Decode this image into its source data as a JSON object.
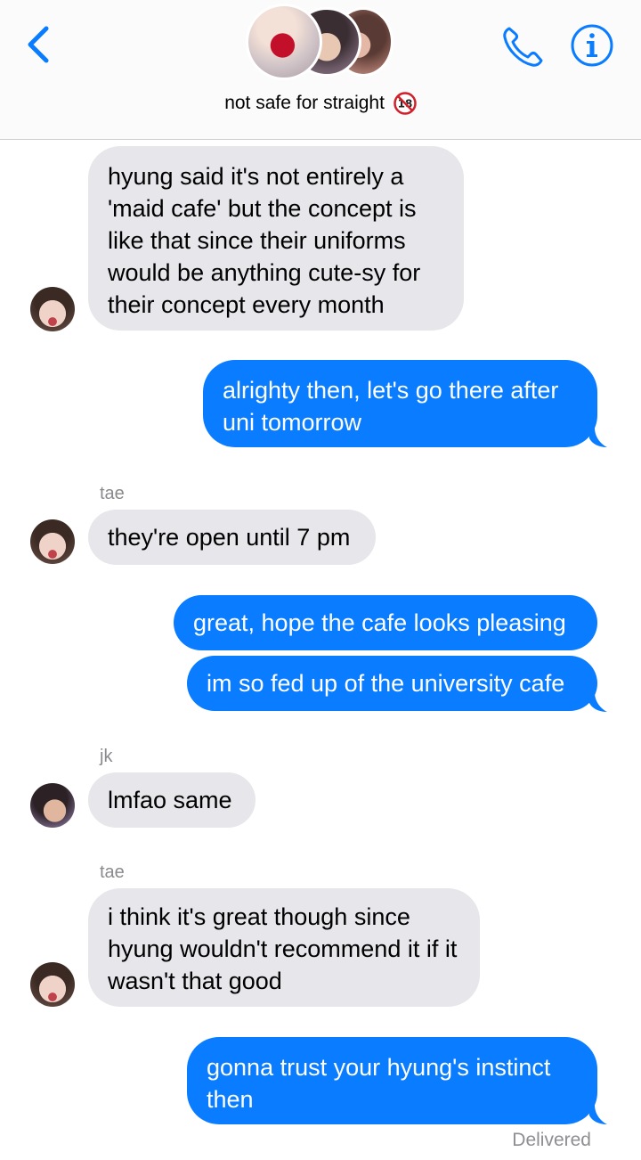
{
  "header": {
    "group_name": "not safe for straight",
    "emoji_badge": "🔞",
    "back_icon": "chevron-left-icon",
    "call_icon": "phone-icon",
    "info_icon": "info-icon",
    "accent_color": "#0a7cff"
  },
  "messages": [
    {
      "direction": "incoming",
      "sender": "",
      "text": "hyung said it's not entirely a 'maid cafe' but the concept is like that since their uniforms would be anything cute-sy for their concept every month"
    },
    {
      "direction": "outgoing",
      "text": "alrighty then, let's go there after uni tomorrow"
    },
    {
      "direction": "incoming",
      "sender": "tae",
      "text": "they're open until 7 pm"
    },
    {
      "direction": "outgoing",
      "text": "great, hope the cafe looks pleasing"
    },
    {
      "direction": "outgoing",
      "text": "im so fed up of the university cafe"
    },
    {
      "direction": "incoming",
      "sender": "jk",
      "text": "lmfao same"
    },
    {
      "direction": "incoming",
      "sender": "tae",
      "text": "i think it's great though since hyung wouldn't recommend it if it wasn't that good"
    },
    {
      "direction": "outgoing",
      "text": "gonna trust your hyung's instinct then"
    }
  ],
  "status": {
    "delivered": "Delivered"
  },
  "colors": {
    "incoming_bubble": "#e6e6eb",
    "outgoing_bubble": "#0a7cff"
  }
}
